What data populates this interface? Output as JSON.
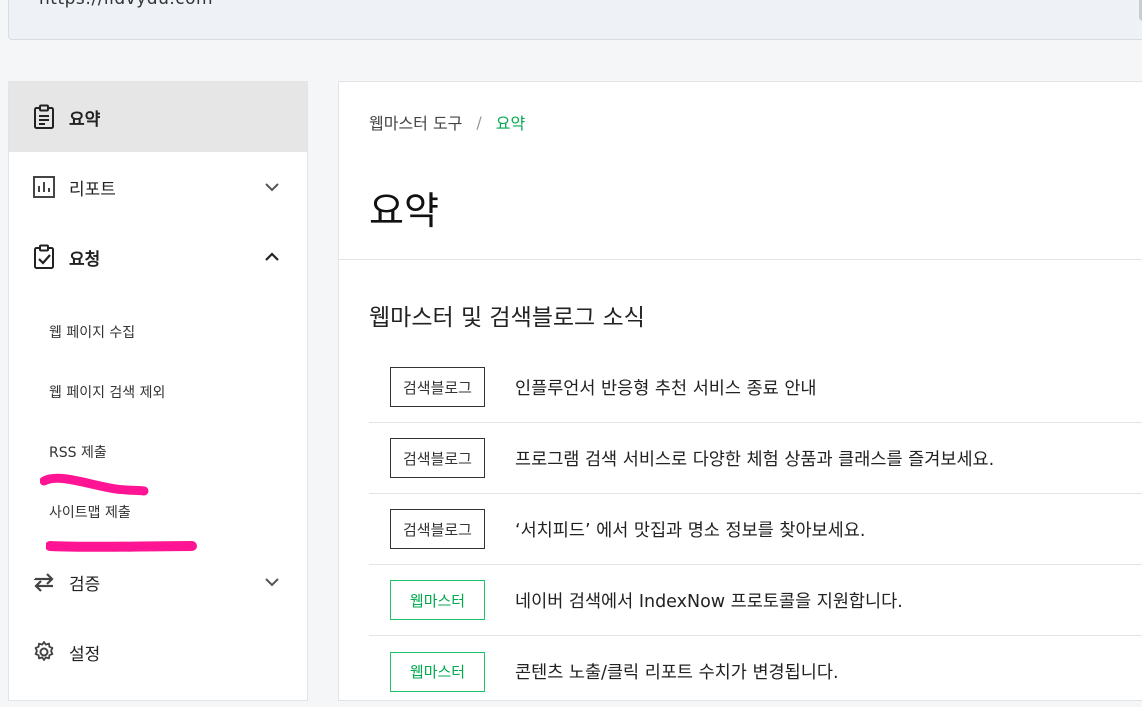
{
  "browser": {
    "url": "https://ildvydu.com"
  },
  "sidebar": {
    "items": [
      {
        "label": "요약",
        "icon": "clipboard-icon"
      },
      {
        "label": "리포트",
        "icon": "bar-chart-icon"
      },
      {
        "label": "요청",
        "icon": "clipboard-check-icon"
      }
    ],
    "subitems": [
      {
        "label": "웹 페이지 수집"
      },
      {
        "label": "웹 페이지 검색 제외"
      },
      {
        "label": "RSS 제출"
      },
      {
        "label": "사이트맵 제출"
      }
    ],
    "bottom_items": [
      {
        "label": "검증",
        "icon": "repeat-arrows-icon"
      },
      {
        "label": "설정",
        "icon": "gear-icon"
      }
    ]
  },
  "main": {
    "breadcrumb": {
      "root": "웹마스터 도구",
      "sep": "/",
      "current": "요약"
    },
    "title": "요약",
    "section_title": "웹마스터 및 검색블로그 소식",
    "news": [
      {
        "badge": "검색블로그",
        "text": "인플루언서 반응형 추천 서비스 종료 안내"
      },
      {
        "badge": "검색블로그",
        "text": "프로그램 검색 서비스로 다양한 체험 상품과 클래스를 즐겨보세요."
      },
      {
        "badge": "검색블로그",
        "text": "‘서치피드’ 에서 맛집과 명소 정보를 찾아보세요."
      },
      {
        "badge": "웹마스터",
        "text": "네이버 검색에서 IndexNow 프로토콜을 지원합니다."
      },
      {
        "badge": "웹마스터",
        "text": "콘텐츠 노출/클릭 리포트 수치가 변경됩니다."
      }
    ]
  },
  "colors": {
    "accent_green": "#03a94f",
    "badge_green_border": "#1ec36a",
    "annotation_pink": "#ff1493"
  }
}
